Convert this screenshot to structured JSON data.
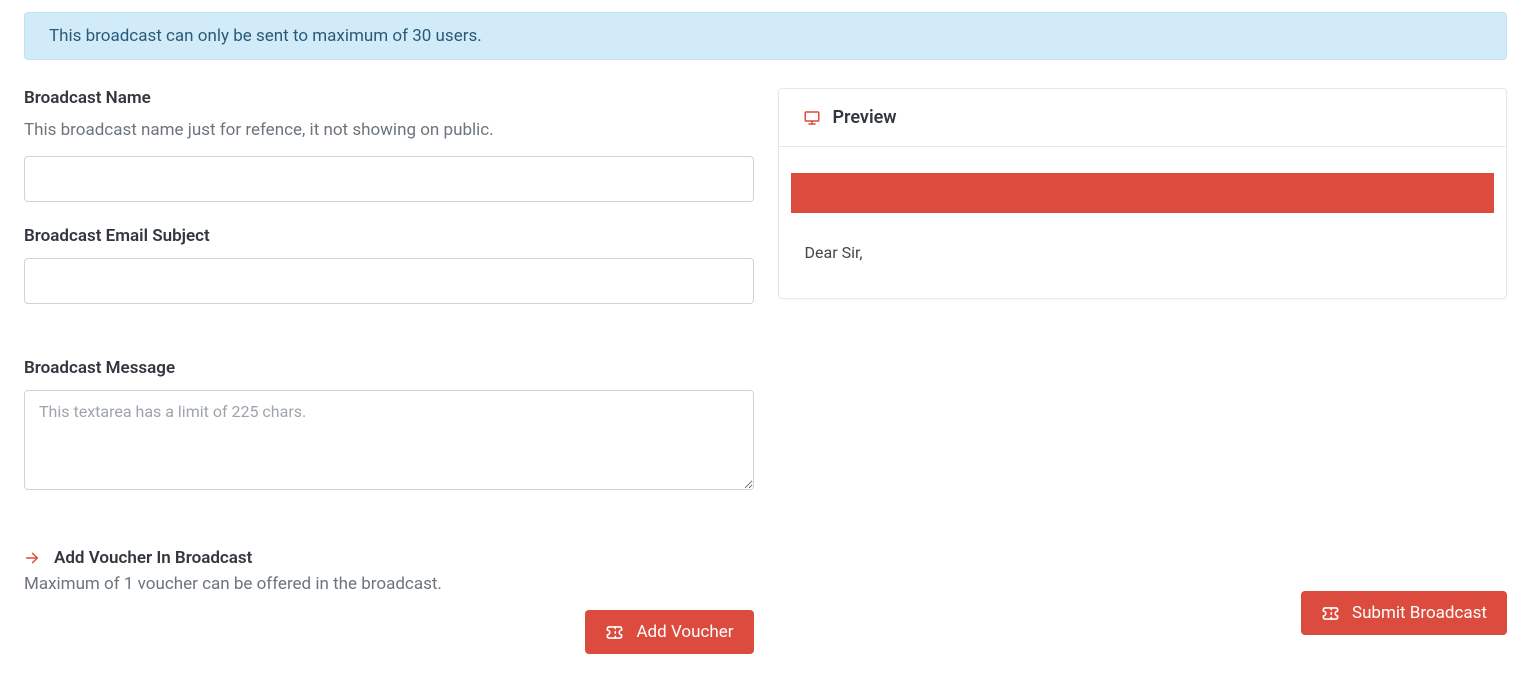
{
  "alert": {
    "text": "This broadcast can only be sent to maximum of 30 users."
  },
  "form": {
    "name": {
      "label": "Broadcast Name",
      "hint": "This broadcast name just for refence, it not showing on public."
    },
    "subject": {
      "label": "Broadcast Email Subject"
    },
    "message": {
      "label": "Broadcast Message",
      "placeholder": "This textarea has a limit of 225 chars."
    },
    "voucher": {
      "label": "Add Voucher In Broadcast",
      "hint": "Maximum of 1 voucher can be offered in the broadcast.",
      "button": "Add Voucher"
    }
  },
  "preview": {
    "title": "Preview",
    "greeting": "Dear Sir,"
  },
  "actions": {
    "submit": "Submit Broadcast"
  }
}
